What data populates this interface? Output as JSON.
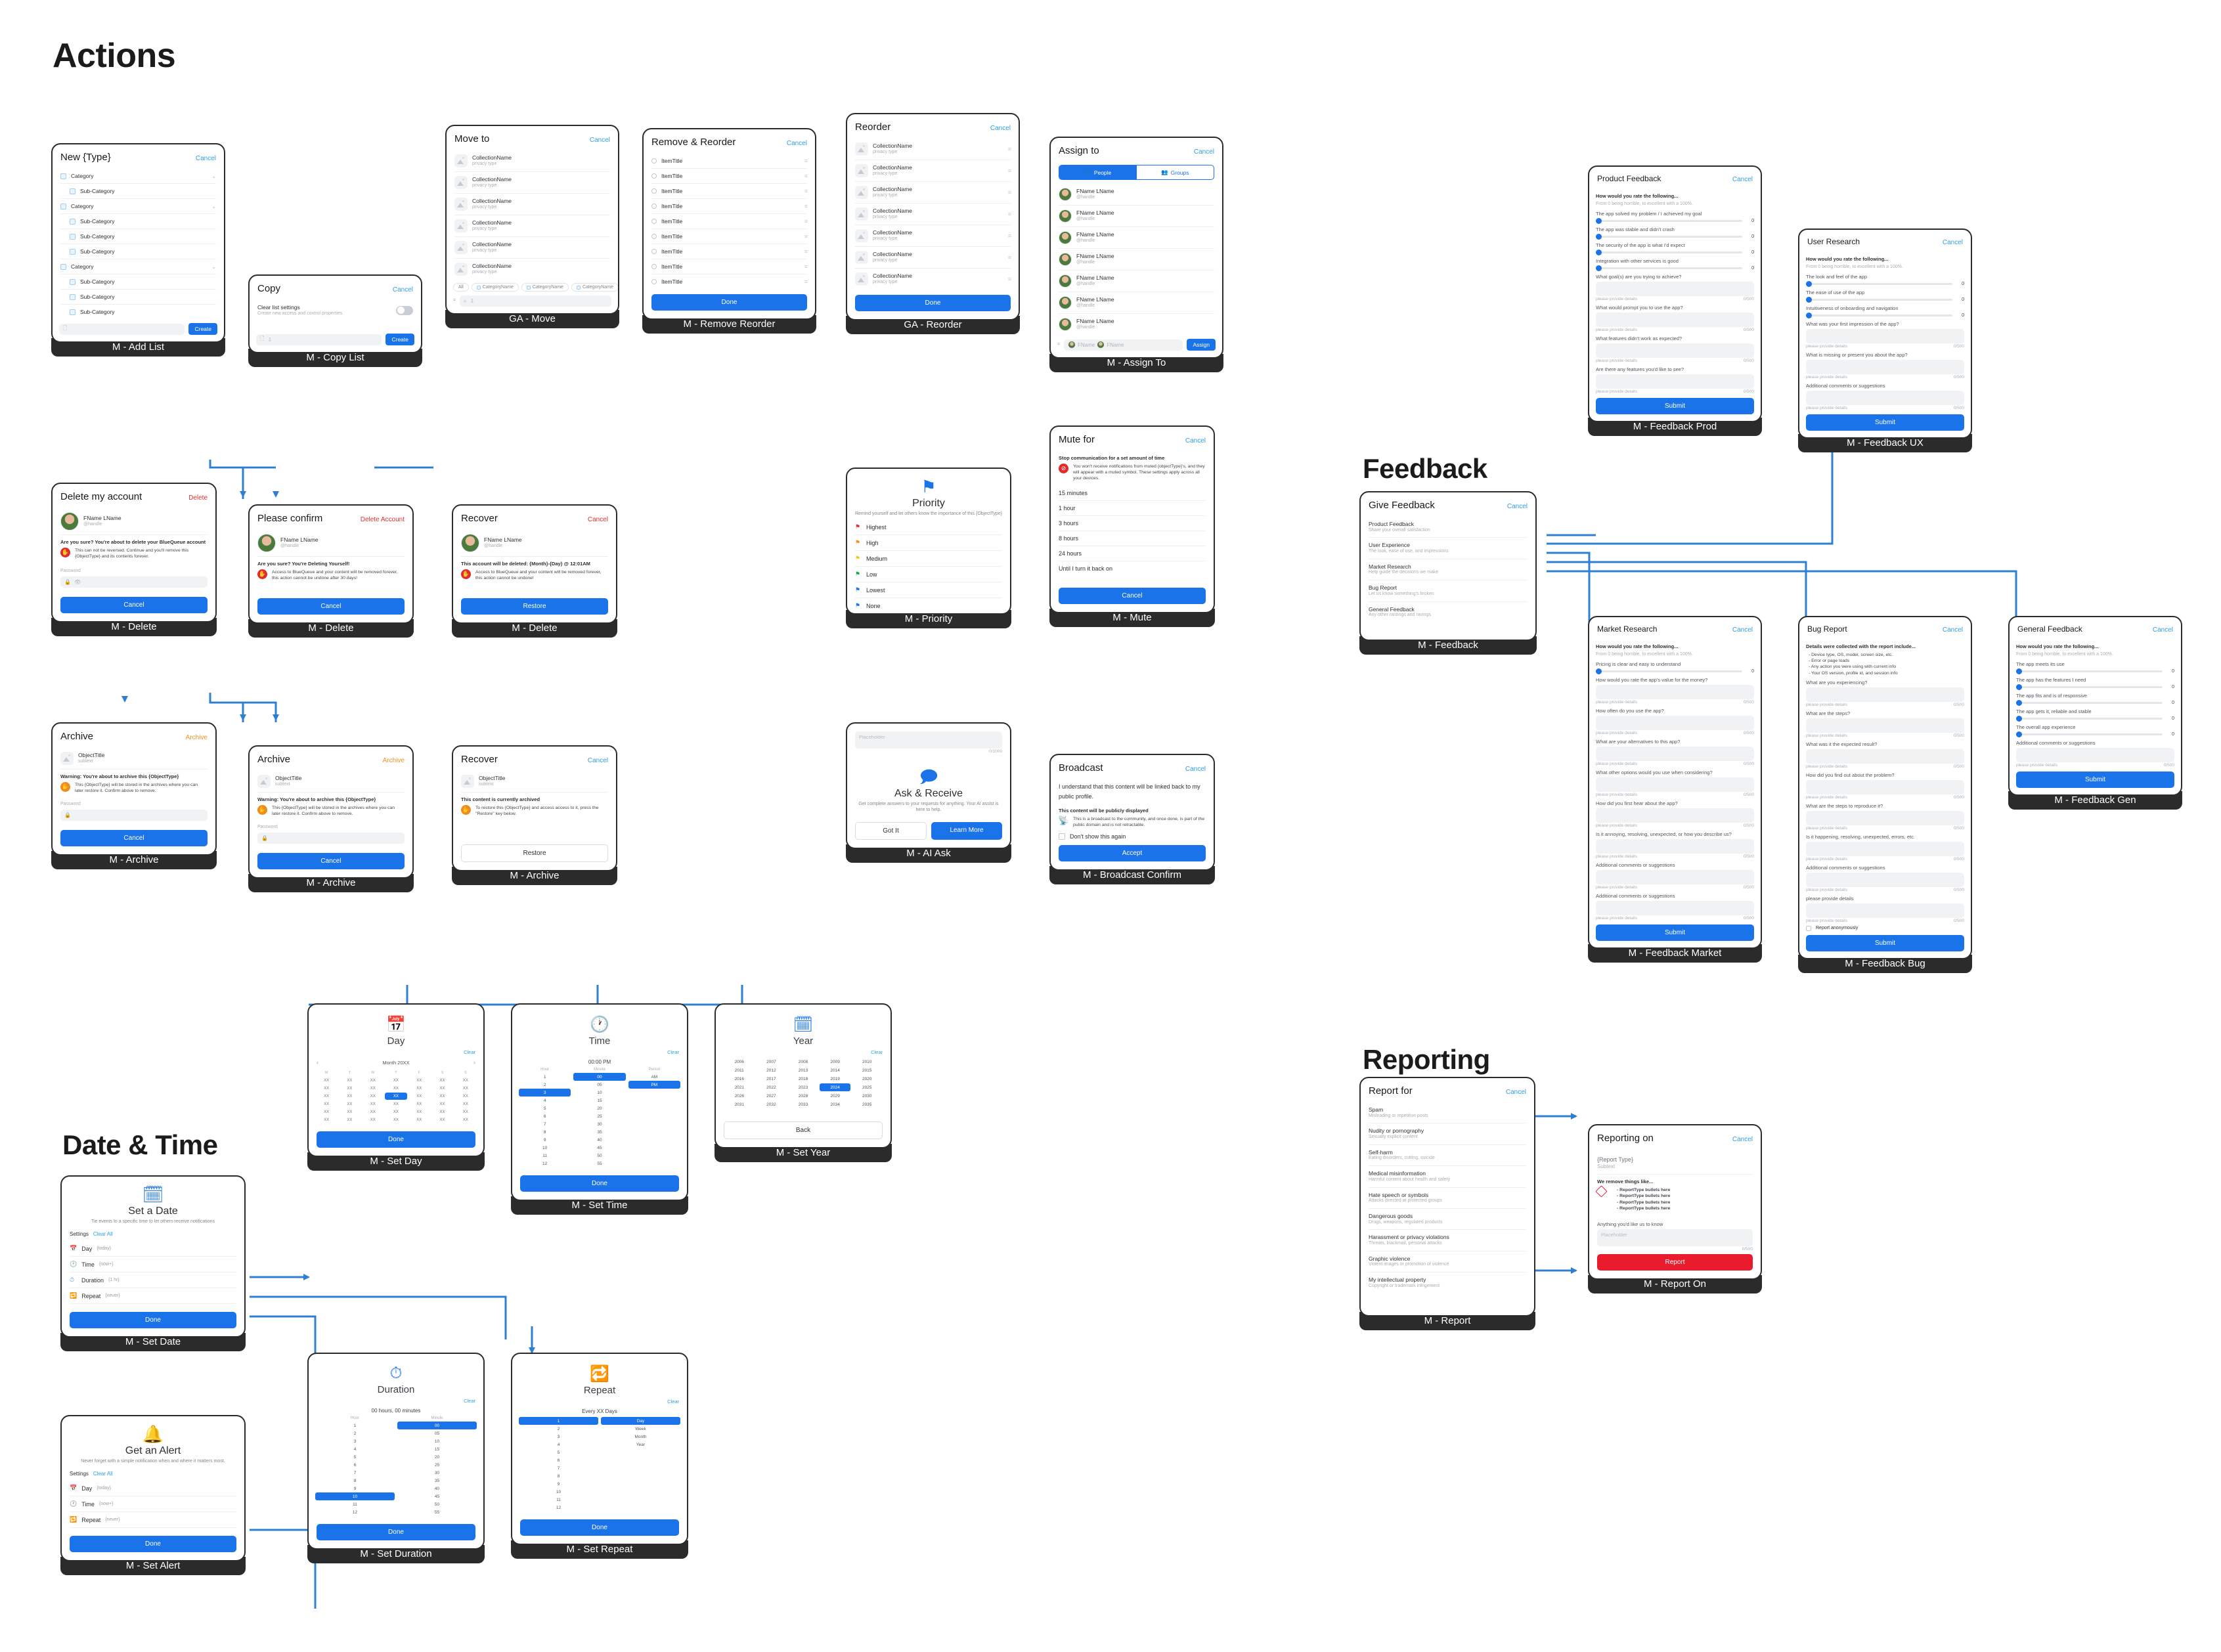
{
  "sections": {
    "actions": "Actions",
    "feedback": "Feedback",
    "reporting": "Reporting",
    "datetime": "Date & Time"
  },
  "common": {
    "cancel": "Cancel",
    "done": "Done",
    "create": "Create",
    "submit": "Submit",
    "restore": "Restore",
    "assign": "Assign",
    "accept": "Accept",
    "report": "Report",
    "back": "Back",
    "clear": "Clear",
    "clear_all": "Clear All",
    "placeholder": "Placeholder",
    "please_provide_details": "please provide details",
    "counter_500": "0/500",
    "counter_1000": "0/1000",
    "password_label": "Password",
    "fname_lname": "FName LName",
    "handle": "@handle",
    "collection_name": "CollectionName",
    "privacy_type": "privacy type",
    "item_title": "ItemTitle",
    "object_title": "ObjectTitle",
    "subtext": "subtext"
  },
  "cards": {
    "add_list": {
      "label": "M - Add List",
      "title": "New {Type}",
      "action": "Cancel",
      "rows": [
        {
          "t": "Category",
          "lvl": 0
        },
        {
          "t": "Sub-Category",
          "lvl": 1
        },
        {
          "t": "Category",
          "lvl": 0
        },
        {
          "t": "Sub-Category",
          "lvl": 1
        },
        {
          "t": "Sub-Category",
          "lvl": 1
        },
        {
          "t": "Sub-Category",
          "lvl": 1
        },
        {
          "t": "Category",
          "lvl": 0
        },
        {
          "t": "Sub-Category",
          "lvl": 1
        },
        {
          "t": "Sub-Category",
          "lvl": 1
        },
        {
          "t": "Sub-Category",
          "lvl": 1
        }
      ],
      "button": "Create"
    },
    "copy_list": {
      "label": "M - Copy List",
      "title": "Copy",
      "action": "Cancel",
      "setting_title": "Clear list settings",
      "setting_sub": "Create new access and control properties",
      "button": "Create"
    },
    "move": {
      "label": "GA - Move",
      "title": "Move to",
      "action": "Cancel",
      "item_count": 6,
      "chips": [
        "All",
        "CategoryName",
        "CategoryName",
        "CategoryName"
      ]
    },
    "remove_reorder": {
      "label": "M - Remove Reorder",
      "title": "Remove & Reorder",
      "action": "Cancel",
      "item_count": 9,
      "button": "Done"
    },
    "reorder": {
      "label": "GA - Reorder",
      "title": "Reorder",
      "action": "Cancel",
      "item_count": 7,
      "button": "Done"
    },
    "assign_to": {
      "label": "M - Assign To",
      "title": "Assign to",
      "action": "Cancel",
      "tabs": [
        "People",
        "Groups"
      ],
      "item_count": 7,
      "chip_name": "FName",
      "button": "Assign"
    },
    "delete_account": {
      "label": "M - Delete",
      "title": "Delete my account",
      "action": "Delete",
      "warn_head": "Are you sure? You're about to delete your BlueQueue account",
      "warn_body": "This can not be reversed. Continue and you'll remove this {ObjectType} and its contents forever.",
      "button": "Cancel"
    },
    "please_confirm": {
      "label": "M - Delete",
      "title": "Please confirm",
      "action": "Delete Account",
      "warn_head": "Are you sure? You're Deleting Yourself!",
      "warn_body": "Access to BlueQueue and your content will be removed forever, this action cannot be undone after 30 days!",
      "button": "Cancel"
    },
    "recover_account": {
      "label": "M - Delete",
      "title": "Recover",
      "action": "Cancel",
      "warn_head": "This account will be deleted: {Month}-{Day} @ 12:01AM",
      "warn_body": "Access to BlueQueue and your content will be removed forever, this action cannot be undone!",
      "button": "Restore"
    },
    "archive": {
      "label": "M - Archive",
      "title": "Archive",
      "action": "Archive",
      "warn_head": "Warning: You're about to archive this {ObjectType}",
      "warn_body": "This {ObjectType} will be stored in the archives where you can later restore it. Confirm above to remove.",
      "button": "Cancel"
    },
    "archive2": {
      "label": "M - Archive",
      "title": "Archive",
      "action": "Archive",
      "warn_head": "Warning: You're about to archive this {ObjectType}",
      "warn_body": "This {ObjectType} will be stored in the archives where you can later restore it. Confirm above to remove.",
      "button": "Cancel"
    },
    "recover_archive": {
      "label": "M - Archive",
      "title": "Recover",
      "action": "Cancel",
      "warn_head": "This content is currently archived",
      "warn_body": "To restore this {ObjectType} and access access to it, press the \"Restore\" key below.",
      "button": "Restore"
    },
    "priority": {
      "label": "M - Priority",
      "title": "Priority",
      "sub": "Remind yourself and let others know the importance of this {ObjectType}",
      "options": [
        {
          "label": "Highest",
          "color": "#e12b2b"
        },
        {
          "label": "High",
          "color": "#f08c1b"
        },
        {
          "label": "Medium",
          "color": "#f2c811"
        },
        {
          "label": "Low",
          "color": "#12a53c"
        },
        {
          "label": "Lowest",
          "color": "#1a73e8"
        },
        {
          "label": "None",
          "color": "#1a73e8"
        }
      ]
    },
    "mute": {
      "label": "M - Mute",
      "title": "Mute for",
      "action": "Cancel",
      "warn_head": "Stop communication for a set amount of time",
      "warn_body": "You won't receive notifications from muted {objectType}'s, and they will appear with a muted symbol. These settings apply across all your devices.",
      "options": [
        "15 minutes",
        "1 hour",
        "3 hours",
        "8 hours",
        "24 hours",
        "Until I turn it back on"
      ],
      "button": "Cancel"
    },
    "ai_ask": {
      "label": "M - AI Ask",
      "placeholder": "Placeholder",
      "counter": "0/1000",
      "title": "Ask & Receive",
      "sub": "Get complete answers to your requests for anything. Your AI assist is here to help.",
      "btn_secondary": "Got It",
      "btn_primary": "Learn More"
    },
    "broadcast": {
      "label": "M - Broadcast Confirm",
      "title": "Broadcast",
      "action": "Cancel",
      "lead": "I understand that this content will be linked back to my public profile.",
      "warn_head": "This content will be publicly displayed",
      "warn_body": "This is a broadcast to the community, and once done, is part of the public domain and is not retractable.",
      "checkbox": "Don't show this again",
      "button": "Accept"
    },
    "give_feedback": {
      "label": "M - Feedback",
      "title": "Give Feedback",
      "action": "Cancel",
      "options": [
        {
          "t": "Product Feedback",
          "s": "Share your overall satisfaction"
        },
        {
          "t": "User Experience",
          "s": "The look, ease of use, and impressions"
        },
        {
          "t": "Market Research",
          "s": "Help guide the decisions we make"
        },
        {
          "t": "Bug Report",
          "s": "Let us know something's broken"
        },
        {
          "t": "General Feedback",
          "s": "Any other rantings and ravings"
        }
      ]
    },
    "feedback_prod": {
      "label": "M - Feedback Prod",
      "title": "Product Feedback",
      "action": "Cancel",
      "head": "How would you rate the following...",
      "sub": "From 0 being horrible, to excellent with a 100%.",
      "sliders": [
        {
          "q": "The app solved my problem / I achieved my goal",
          "v": "0"
        },
        {
          "q": "The app was stable and didn't crash",
          "v": "0"
        },
        {
          "q": "The security of the app is what I'd expect",
          "v": "0"
        },
        {
          "q": "Integration with other services is good",
          "v": "0"
        }
      ],
      "questions": [
        "What goal(s) are you trying to achieve?",
        "What would prompt you to use the app?",
        "What features didn't work as expected?",
        "Are there any features you'd like to see?"
      ],
      "button": "Submit"
    },
    "feedback_ux": {
      "label": "M - Feedback UX",
      "title": "User Research",
      "action": "Cancel",
      "head": "How would you rate the following...",
      "sub": "From 0 being horrible, to excellent with a 100%.",
      "sliders": [
        {
          "q": "The look and feel of the app",
          "v": "0"
        },
        {
          "q": "The ease of use of the app",
          "v": "0"
        },
        {
          "q": "Intuitiveness of onboarding and navigation",
          "v": "0"
        }
      ],
      "questions": [
        "What was your first impression of the app?",
        "What is missing or present you about the app?",
        "Additional comments or suggestions"
      ],
      "button": "Submit"
    },
    "feedback_market": {
      "label": "M - Feedback Market",
      "title": "Market Research",
      "action": "Cancel",
      "head": "How would you rate the following...",
      "sub": "From 0 being horrible, to excellent with a 100%.",
      "sliders": [
        {
          "q": "Pricing is clear and easy to understand",
          "v": "0"
        }
      ],
      "questions": [
        "How would you rate the app's value for the money?",
        "How often do you use the app?",
        "What are your alternatives to this app?",
        "What other options would you use when considering?",
        "How did you first hear about the app?",
        "Is it annoying, resolving, unexpected, or how you describe us?",
        "Additional comments or suggestions",
        "Additional comments or suggestions"
      ],
      "button": "Submit"
    },
    "feedback_bug": {
      "label": "M - Feedback Bug",
      "title": "Bug Report",
      "action": "Cancel",
      "head": "Details were collected with the report include...",
      "bullets": [
        "- Device type, OS, model, screen size, etc.",
        "- Error or page loads",
        "- Any action you were using with current info",
        "- Your OS version, profile id, and session info"
      ],
      "questions": [
        "What are you experiencing?",
        "What are the steps?",
        "What was it the expected result?",
        "How did you find out about the problem?",
        "What are the steps to reproduce it?",
        "Is it happening, resolving, unexpected, errors, etc.",
        "Additional comments or suggestions",
        "please provide details"
      ],
      "checkbox": "Report anonymously",
      "button": "Submit"
    },
    "feedback_gen": {
      "label": "M - Feedback Gen",
      "title": "General Feedback",
      "action": "Cancel",
      "head": "How would you rate the following...",
      "sub": "From 0 being horrible, to excellent with a 100%.",
      "sliders": [
        {
          "q": "The app meets its use",
          "v": "0"
        },
        {
          "q": "The app has the features I need",
          "v": "0"
        },
        {
          "q": "The app fits and is of responsive",
          "v": "0"
        },
        {
          "q": "The app gets it, reliable and stable",
          "v": "0"
        },
        {
          "q": "The overall app experience",
          "v": "0"
        }
      ],
      "questions": [
        "Additional comments or suggestions"
      ],
      "button": "Submit"
    },
    "report": {
      "label": "M - Report",
      "title": "Report for",
      "action": "Cancel",
      "options": [
        {
          "t": "Spam",
          "s": "Misleading or repetitive posts"
        },
        {
          "t": "Nudity or pornography",
          "s": "Sexually explicit content"
        },
        {
          "t": "Self-harm",
          "s": "Eating disorders, cutting, suicide"
        },
        {
          "t": "Medical misinformation",
          "s": "Harmful content about health and safety"
        },
        {
          "t": "Hate speech or symbols",
          "s": "Attacks directed at protected groups"
        },
        {
          "t": "Dangerous goods",
          "s": "Drugs, weapons, regulated products"
        },
        {
          "t": "Harassment or privacy violations",
          "s": "Threats, blackmail, personal attacks"
        },
        {
          "t": "Graphic violence",
          "s": "Violent images or promotion of violence"
        },
        {
          "t": "My intellectual property",
          "s": "Copyright or trademark infrigement"
        }
      ]
    },
    "report_on": {
      "label": "M - Report On",
      "title": "Reporting on",
      "action": "Cancel",
      "type": "{Report Type}",
      "subtext": "Subtext",
      "warn_head": "We remove things like...",
      "bullets": [
        "- ReportType bullets here",
        "- ReportType bullets here",
        "- ReportType bullets here",
        "- ReportType bullets here"
      ],
      "q": "Anything you'd like us to know",
      "counter": "0/500",
      "button": "Report"
    },
    "set_date": {
      "label": "M - Set Date",
      "icon_title": "Set a Date",
      "sub": "Tie events to a specific time to let others receive notifications",
      "settings": "Settings",
      "clear_all": "Clear All",
      "rows": [
        {
          "t": "Day",
          "v": "{today}"
        },
        {
          "t": "Time",
          "v": "{now+}"
        },
        {
          "t": "Duration",
          "v": "{1 hr}"
        },
        {
          "t": "Repeat",
          "v": "{never}"
        }
      ],
      "button": "Done"
    },
    "set_alert": {
      "label": "M - Set Alert",
      "icon_title": "Get an Alert",
      "sub": "Never forget with a simple notification when and where it matters most.",
      "settings": "Settings",
      "clear_all": "Clear All",
      "rows": [
        {
          "t": "Day",
          "v": "{today}"
        },
        {
          "t": "Time",
          "v": "{now+}"
        },
        {
          "t": "Repeat",
          "v": "{never}"
        }
      ],
      "button": "Done"
    },
    "set_day": {
      "label": "M - Set Day",
      "title": "Day",
      "clear": "Clear",
      "month": "Month 20XX",
      "dow": [
        "M",
        "T",
        "W",
        "T",
        "F",
        "S",
        "S"
      ],
      "selected": "XX",
      "button": "Done"
    },
    "set_time": {
      "label": "M - Set Time",
      "title": "Time",
      "clear": "Clear",
      "value": "00:00 PM",
      "cols": [
        "Hour",
        "Minute",
        "Period"
      ],
      "hours": [
        "1",
        "2",
        "3",
        "4",
        "5",
        "6",
        "7",
        "8",
        "9",
        "10",
        "11",
        "12"
      ],
      "minutes": [
        "00",
        "05",
        "10",
        "15",
        "20",
        "25",
        "30",
        "35",
        "40",
        "45",
        "50",
        "55"
      ],
      "periods": [
        "AM",
        "PM"
      ],
      "sel_hour": "3",
      "sel_minute": "00",
      "sel_period": "PM",
      "button": "Done"
    },
    "set_year": {
      "label": "M - Set Year",
      "title": "Year",
      "clear": "Clear",
      "years": [
        [
          "2006",
          "2007",
          "2008",
          "2009",
          "2010"
        ],
        [
          "2011",
          "2012",
          "2013",
          "2014",
          "2015"
        ],
        [
          "2016",
          "2017",
          "2018",
          "2019",
          "2020"
        ],
        [
          "2021",
          "2022",
          "2023",
          "2024",
          "2025"
        ],
        [
          "2026",
          "2027",
          "2028",
          "2029",
          "2030"
        ],
        [
          "2031",
          "2032",
          "2033",
          "2034",
          "2035"
        ]
      ],
      "selected": "2024",
      "button": "Back"
    },
    "set_duration": {
      "label": "M - Set Duration",
      "title": "Duration",
      "clear": "Clear",
      "value": "00 hours, 00 minutes",
      "cols": [
        "Hour",
        "Minute"
      ],
      "sel_hour": "10",
      "sel_minute": "00",
      "button": "Done"
    },
    "set_repeat": {
      "label": "M - Set Repeat",
      "title": "Repeat",
      "clear": "Clear",
      "value": "Every XX Days",
      "units": [
        "Day",
        "Week",
        "Month",
        "Year"
      ],
      "sel_num": "1",
      "sel_unit": "Day",
      "button": "Done"
    }
  },
  "colors": {
    "primary": "#1a73e8",
    "link": "#2e9fe0",
    "danger": "#ea1b2d",
    "warning": "#f08c1b",
    "frame": "#2b2b2b"
  }
}
